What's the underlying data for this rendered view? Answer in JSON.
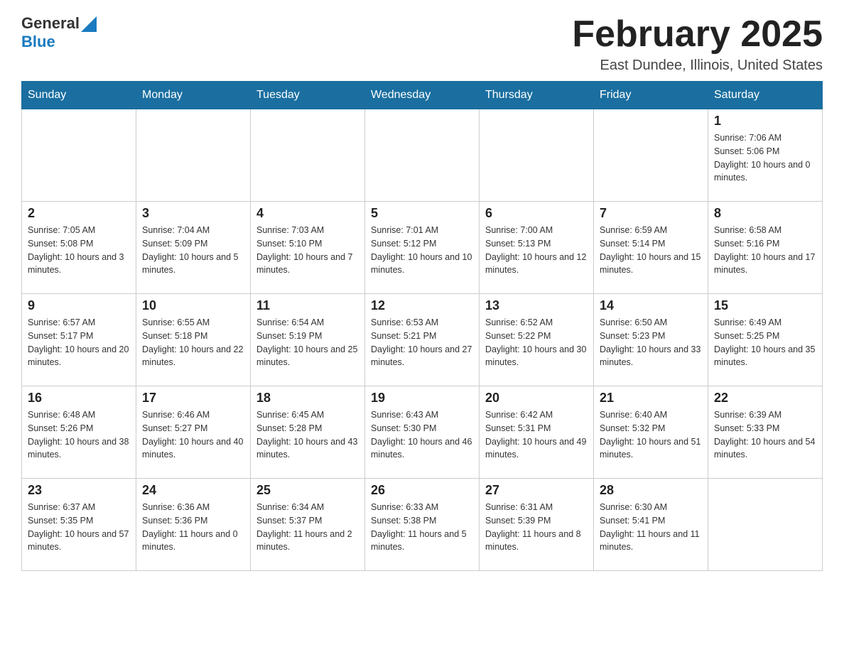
{
  "header": {
    "logo_general": "General",
    "logo_blue": "Blue",
    "month_title": "February 2025",
    "location": "East Dundee, Illinois, United States"
  },
  "days_of_week": [
    "Sunday",
    "Monday",
    "Tuesday",
    "Wednesday",
    "Thursday",
    "Friday",
    "Saturday"
  ],
  "weeks": [
    [
      {
        "day": "",
        "info": ""
      },
      {
        "day": "",
        "info": ""
      },
      {
        "day": "",
        "info": ""
      },
      {
        "day": "",
        "info": ""
      },
      {
        "day": "",
        "info": ""
      },
      {
        "day": "",
        "info": ""
      },
      {
        "day": "1",
        "info": "Sunrise: 7:06 AM\nSunset: 5:06 PM\nDaylight: 10 hours and 0 minutes."
      }
    ],
    [
      {
        "day": "2",
        "info": "Sunrise: 7:05 AM\nSunset: 5:08 PM\nDaylight: 10 hours and 3 minutes."
      },
      {
        "day": "3",
        "info": "Sunrise: 7:04 AM\nSunset: 5:09 PM\nDaylight: 10 hours and 5 minutes."
      },
      {
        "day": "4",
        "info": "Sunrise: 7:03 AM\nSunset: 5:10 PM\nDaylight: 10 hours and 7 minutes."
      },
      {
        "day": "5",
        "info": "Sunrise: 7:01 AM\nSunset: 5:12 PM\nDaylight: 10 hours and 10 minutes."
      },
      {
        "day": "6",
        "info": "Sunrise: 7:00 AM\nSunset: 5:13 PM\nDaylight: 10 hours and 12 minutes."
      },
      {
        "day": "7",
        "info": "Sunrise: 6:59 AM\nSunset: 5:14 PM\nDaylight: 10 hours and 15 minutes."
      },
      {
        "day": "8",
        "info": "Sunrise: 6:58 AM\nSunset: 5:16 PM\nDaylight: 10 hours and 17 minutes."
      }
    ],
    [
      {
        "day": "9",
        "info": "Sunrise: 6:57 AM\nSunset: 5:17 PM\nDaylight: 10 hours and 20 minutes."
      },
      {
        "day": "10",
        "info": "Sunrise: 6:55 AM\nSunset: 5:18 PM\nDaylight: 10 hours and 22 minutes."
      },
      {
        "day": "11",
        "info": "Sunrise: 6:54 AM\nSunset: 5:19 PM\nDaylight: 10 hours and 25 minutes."
      },
      {
        "day": "12",
        "info": "Sunrise: 6:53 AM\nSunset: 5:21 PM\nDaylight: 10 hours and 27 minutes."
      },
      {
        "day": "13",
        "info": "Sunrise: 6:52 AM\nSunset: 5:22 PM\nDaylight: 10 hours and 30 minutes."
      },
      {
        "day": "14",
        "info": "Sunrise: 6:50 AM\nSunset: 5:23 PM\nDaylight: 10 hours and 33 minutes."
      },
      {
        "day": "15",
        "info": "Sunrise: 6:49 AM\nSunset: 5:25 PM\nDaylight: 10 hours and 35 minutes."
      }
    ],
    [
      {
        "day": "16",
        "info": "Sunrise: 6:48 AM\nSunset: 5:26 PM\nDaylight: 10 hours and 38 minutes."
      },
      {
        "day": "17",
        "info": "Sunrise: 6:46 AM\nSunset: 5:27 PM\nDaylight: 10 hours and 40 minutes."
      },
      {
        "day": "18",
        "info": "Sunrise: 6:45 AM\nSunset: 5:28 PM\nDaylight: 10 hours and 43 minutes."
      },
      {
        "day": "19",
        "info": "Sunrise: 6:43 AM\nSunset: 5:30 PM\nDaylight: 10 hours and 46 minutes."
      },
      {
        "day": "20",
        "info": "Sunrise: 6:42 AM\nSunset: 5:31 PM\nDaylight: 10 hours and 49 minutes."
      },
      {
        "day": "21",
        "info": "Sunrise: 6:40 AM\nSunset: 5:32 PM\nDaylight: 10 hours and 51 minutes."
      },
      {
        "day": "22",
        "info": "Sunrise: 6:39 AM\nSunset: 5:33 PM\nDaylight: 10 hours and 54 minutes."
      }
    ],
    [
      {
        "day": "23",
        "info": "Sunrise: 6:37 AM\nSunset: 5:35 PM\nDaylight: 10 hours and 57 minutes."
      },
      {
        "day": "24",
        "info": "Sunrise: 6:36 AM\nSunset: 5:36 PM\nDaylight: 11 hours and 0 minutes."
      },
      {
        "day": "25",
        "info": "Sunrise: 6:34 AM\nSunset: 5:37 PM\nDaylight: 11 hours and 2 minutes."
      },
      {
        "day": "26",
        "info": "Sunrise: 6:33 AM\nSunset: 5:38 PM\nDaylight: 11 hours and 5 minutes."
      },
      {
        "day": "27",
        "info": "Sunrise: 6:31 AM\nSunset: 5:39 PM\nDaylight: 11 hours and 8 minutes."
      },
      {
        "day": "28",
        "info": "Sunrise: 6:30 AM\nSunset: 5:41 PM\nDaylight: 11 hours and 11 minutes."
      },
      {
        "day": "",
        "info": ""
      }
    ]
  ]
}
